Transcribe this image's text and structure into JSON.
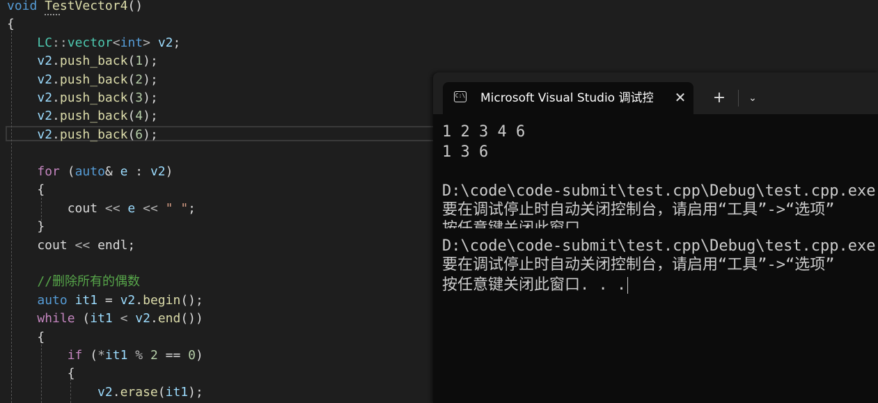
{
  "editor": {
    "lines": [
      {
        "parts": [
          {
            "c": "kw",
            "t": "void"
          },
          {
            "c": "pl",
            "t": " "
          },
          {
            "c": "fn",
            "t": "TestVector4"
          },
          {
            "c": "pl",
            "t": "()"
          }
        ]
      },
      {
        "parts": [
          {
            "c": "pl",
            "t": "{"
          }
        ]
      },
      {
        "parts": [
          {
            "c": "pl",
            "t": "    "
          },
          {
            "c": "ty",
            "t": "LC"
          },
          {
            "c": "op",
            "t": "::"
          },
          {
            "c": "ty",
            "t": "vector"
          },
          {
            "c": "op",
            "t": "<"
          },
          {
            "c": "kw",
            "t": "int"
          },
          {
            "c": "op",
            "t": ">"
          },
          {
            "c": "pl",
            "t": " "
          },
          {
            "c": "id",
            "t": "v2"
          },
          {
            "c": "pl",
            "t": ";"
          }
        ]
      },
      {
        "parts": [
          {
            "c": "pl",
            "t": "    "
          },
          {
            "c": "id",
            "t": "v2"
          },
          {
            "c": "pl",
            "t": "."
          },
          {
            "c": "fn",
            "t": "push_back"
          },
          {
            "c": "pl",
            "t": "("
          },
          {
            "c": "num",
            "t": "1"
          },
          {
            "c": "pl",
            "t": ");"
          }
        ]
      },
      {
        "parts": [
          {
            "c": "pl",
            "t": "    "
          },
          {
            "c": "id",
            "t": "v2"
          },
          {
            "c": "pl",
            "t": "."
          },
          {
            "c": "fn",
            "t": "push_back"
          },
          {
            "c": "pl",
            "t": "("
          },
          {
            "c": "num",
            "t": "2"
          },
          {
            "c": "pl",
            "t": ");"
          }
        ]
      },
      {
        "parts": [
          {
            "c": "pl",
            "t": "    "
          },
          {
            "c": "id",
            "t": "v2"
          },
          {
            "c": "pl",
            "t": "."
          },
          {
            "c": "fn",
            "t": "push_back"
          },
          {
            "c": "pl",
            "t": "("
          },
          {
            "c": "num",
            "t": "3"
          },
          {
            "c": "pl",
            "t": ");"
          }
        ]
      },
      {
        "parts": [
          {
            "c": "pl",
            "t": "    "
          },
          {
            "c": "id",
            "t": "v2"
          },
          {
            "c": "pl",
            "t": "."
          },
          {
            "c": "fn",
            "t": "push_back"
          },
          {
            "c": "pl",
            "t": "("
          },
          {
            "c": "num",
            "t": "4"
          },
          {
            "c": "pl",
            "t": ");"
          }
        ]
      },
      {
        "parts": [
          {
            "c": "pl",
            "t": "    "
          },
          {
            "c": "id",
            "t": "v2"
          },
          {
            "c": "pl",
            "t": "."
          },
          {
            "c": "fn",
            "t": "push_back"
          },
          {
            "c": "pl",
            "t": "("
          },
          {
            "c": "num",
            "t": "6"
          },
          {
            "c": "pl",
            "t": ");"
          }
        ]
      },
      {
        "parts": []
      },
      {
        "parts": [
          {
            "c": "pl",
            "t": "    "
          },
          {
            "c": "kw2",
            "t": "for"
          },
          {
            "c": "pl",
            "t": " ("
          },
          {
            "c": "kw",
            "t": "auto"
          },
          {
            "c": "pl",
            "t": "& "
          },
          {
            "c": "id",
            "t": "e"
          },
          {
            "c": "pl",
            "t": " : "
          },
          {
            "c": "id",
            "t": "v2"
          },
          {
            "c": "pl",
            "t": ")"
          }
        ]
      },
      {
        "parts": [
          {
            "c": "pl",
            "t": "    {"
          }
        ]
      },
      {
        "parts": [
          {
            "c": "pl",
            "t": "        cout "
          },
          {
            "c": "op",
            "t": "<<"
          },
          {
            "c": "pl",
            "t": " "
          },
          {
            "c": "id",
            "t": "e"
          },
          {
            "c": "pl",
            "t": " "
          },
          {
            "c": "op",
            "t": "<<"
          },
          {
            "c": "pl",
            "t": " "
          },
          {
            "c": "str",
            "t": "\" \""
          },
          {
            "c": "pl",
            "t": ";"
          }
        ]
      },
      {
        "parts": [
          {
            "c": "pl",
            "t": "    }"
          }
        ]
      },
      {
        "parts": [
          {
            "c": "pl",
            "t": "    cout "
          },
          {
            "c": "op",
            "t": "<<"
          },
          {
            "c": "pl",
            "t": " endl;"
          }
        ]
      },
      {
        "parts": []
      },
      {
        "parts": [
          {
            "c": "pl",
            "t": "    "
          },
          {
            "c": "cmt",
            "t": "//删除所有的偶数"
          }
        ]
      },
      {
        "parts": [
          {
            "c": "pl",
            "t": "    "
          },
          {
            "c": "kw",
            "t": "auto"
          },
          {
            "c": "pl",
            "t": " "
          },
          {
            "c": "id",
            "t": "it1"
          },
          {
            "c": "pl",
            "t": " = "
          },
          {
            "c": "id",
            "t": "v2"
          },
          {
            "c": "pl",
            "t": "."
          },
          {
            "c": "fn",
            "t": "begin"
          },
          {
            "c": "pl",
            "t": "();"
          }
        ]
      },
      {
        "parts": [
          {
            "c": "pl",
            "t": "    "
          },
          {
            "c": "kw2",
            "t": "while"
          },
          {
            "c": "pl",
            "t": " ("
          },
          {
            "c": "id",
            "t": "it1"
          },
          {
            "c": "pl",
            "t": " "
          },
          {
            "c": "op",
            "t": "<"
          },
          {
            "c": "pl",
            "t": " "
          },
          {
            "c": "id",
            "t": "v2"
          },
          {
            "c": "pl",
            "t": "."
          },
          {
            "c": "fn",
            "t": "end"
          },
          {
            "c": "pl",
            "t": "())"
          }
        ]
      },
      {
        "parts": [
          {
            "c": "pl",
            "t": "    {"
          }
        ]
      },
      {
        "parts": [
          {
            "c": "pl",
            "t": "        "
          },
          {
            "c": "kw2",
            "t": "if"
          },
          {
            "c": "pl",
            "t": " ("
          },
          {
            "c": "op",
            "t": "*"
          },
          {
            "c": "id",
            "t": "it1"
          },
          {
            "c": "pl",
            "t": " "
          },
          {
            "c": "op",
            "t": "%"
          },
          {
            "c": "pl",
            "t": " "
          },
          {
            "c": "num",
            "t": "2"
          },
          {
            "c": "pl",
            "t": " == "
          },
          {
            "c": "num",
            "t": "0"
          },
          {
            "c": "pl",
            "t": ")"
          }
        ]
      },
      {
        "parts": [
          {
            "c": "pl",
            "t": "        {"
          }
        ]
      },
      {
        "parts": [
          {
            "c": "pl",
            "t": "            "
          },
          {
            "c": "id",
            "t": "v2"
          },
          {
            "c": "pl",
            "t": "."
          },
          {
            "c": "fn",
            "t": "erase"
          },
          {
            "c": "pl",
            "t": "("
          },
          {
            "c": "id",
            "t": "it1"
          },
          {
            "c": "pl",
            "t": ");"
          }
        ]
      }
    ]
  },
  "terminal": {
    "tab_title": "Microsoft Visual Studio 调试控制台",
    "tab_icon_text": "C:\\",
    "close_label": "✕",
    "new_tab_label": "+",
    "dropdown_label": "⌄",
    "output_upper": [
      "1 2 3 4 6",
      "1 3 6",
      "",
      "D:\\code\\code-submit\\test.cpp\\Debug\\test.cpp.exe",
      "要在调试停止时自动关闭控制台，请启用“工具”->“选项”",
      "按任意键关闭此窗口. . ."
    ],
    "output_lower": [
      "D:\\code\\code-submit\\test.cpp\\Debug\\test.cpp.exe",
      "要在调试停止时自动关闭控制台，请启用“工具”->“选项”",
      "按任意键关闭此窗口. . ."
    ]
  }
}
